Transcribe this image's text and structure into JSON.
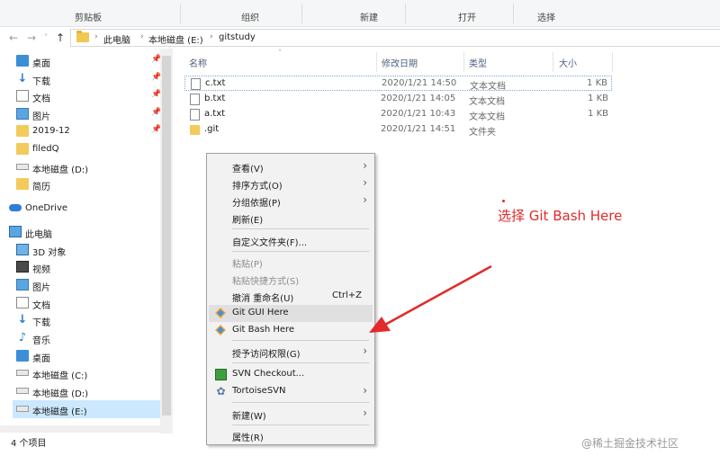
{
  "ribbon": {
    "groups": [
      "剪贴板",
      "组织",
      "新建",
      "打开",
      "选择"
    ]
  },
  "address": {
    "crumbs": [
      "此电脑",
      "本地磁盘 (E:)",
      "gitstudy"
    ]
  },
  "nav": {
    "items": [
      {
        "label": "桌面",
        "icon": "desktop-icon",
        "pinned": true
      },
      {
        "label": "下载",
        "icon": "download-icon",
        "pinned": true
      },
      {
        "label": "文档",
        "icon": "document-icon",
        "pinned": true
      },
      {
        "label": "图片",
        "icon": "picture-icon",
        "pinned": true
      },
      {
        "label": "2019-12",
        "icon": "folder-icon",
        "pinned": true
      },
      {
        "label": "filedQ",
        "icon": "folder-icon",
        "pinned": false
      },
      {
        "label": "本地磁盘 (D:)",
        "icon": "drive-icon",
        "pinned": false
      },
      {
        "label": "简历",
        "icon": "folder-icon",
        "pinned": false
      },
      {
        "label": "OneDrive",
        "icon": "onedrive-icon",
        "pinned": false
      },
      {
        "label": "此电脑",
        "icon": "pc-icon",
        "pinned": false
      },
      {
        "label": "3D 对象",
        "icon": "3d-objects-icon",
        "pinned": false
      },
      {
        "label": "视频",
        "icon": "video-icon",
        "pinned": false
      },
      {
        "label": "图片",
        "icon": "picture-icon",
        "pinned": false
      },
      {
        "label": "文档",
        "icon": "document-icon",
        "pinned": false
      },
      {
        "label": "下载",
        "icon": "download-icon",
        "pinned": false
      },
      {
        "label": "音乐",
        "icon": "music-icon",
        "pinned": false
      },
      {
        "label": "桌面",
        "icon": "desktop-icon",
        "pinned": false
      },
      {
        "label": "本地磁盘 (C:)",
        "icon": "drive-icon",
        "pinned": false
      },
      {
        "label": "本地磁盘 (D:)",
        "icon": "drive-icon",
        "pinned": false
      },
      {
        "label": "本地磁盘 (E:)",
        "icon": "drive-icon",
        "pinned": false,
        "selected": true
      }
    ]
  },
  "columns": {
    "name": "名称",
    "date": "修改日期",
    "type": "类型",
    "size": "大小"
  },
  "files": [
    {
      "name": "c.txt",
      "date": "2020/1/21 14:50",
      "type": "文本文档",
      "size": "1 KB",
      "kind": "file"
    },
    {
      "name": "b.txt",
      "date": "2020/1/21 14:05",
      "type": "文本文档",
      "size": "1 KB",
      "kind": "file"
    },
    {
      "name": "a.txt",
      "date": "2020/1/21 10:43",
      "type": "文本文档",
      "size": "1 KB",
      "kind": "file"
    },
    {
      "name": ".git",
      "date": "2020/1/21 14:51",
      "type": "文件夹",
      "size": "",
      "kind": "folder"
    }
  ],
  "context_menu": {
    "view": "查看(V)",
    "sort": "排序方式(O)",
    "group": "分组依据(P)",
    "refresh": "刷新(E)",
    "customize": "自定义文件夹(F)...",
    "paste": "粘贴(P)",
    "paste_shortcut": "粘贴快捷方式(S)",
    "undo": "撤消 重命名(U)",
    "undo_shortcut": "Ctrl+Z",
    "git_gui": "Git GUI Here",
    "git_bash": "Git Bash Here",
    "grant_access": "授予访问权限(G)",
    "svn_checkout": "SVN Checkout...",
    "tortoise": "TortoiseSVN",
    "new": "新建(W)",
    "properties": "属性(R)"
  },
  "status": {
    "count": "4 个项目"
  },
  "annotation": {
    "text": "选择 Git Bash Here",
    "color": "#e22a2a"
  },
  "watermark": "@稀土掘金技术社区"
}
